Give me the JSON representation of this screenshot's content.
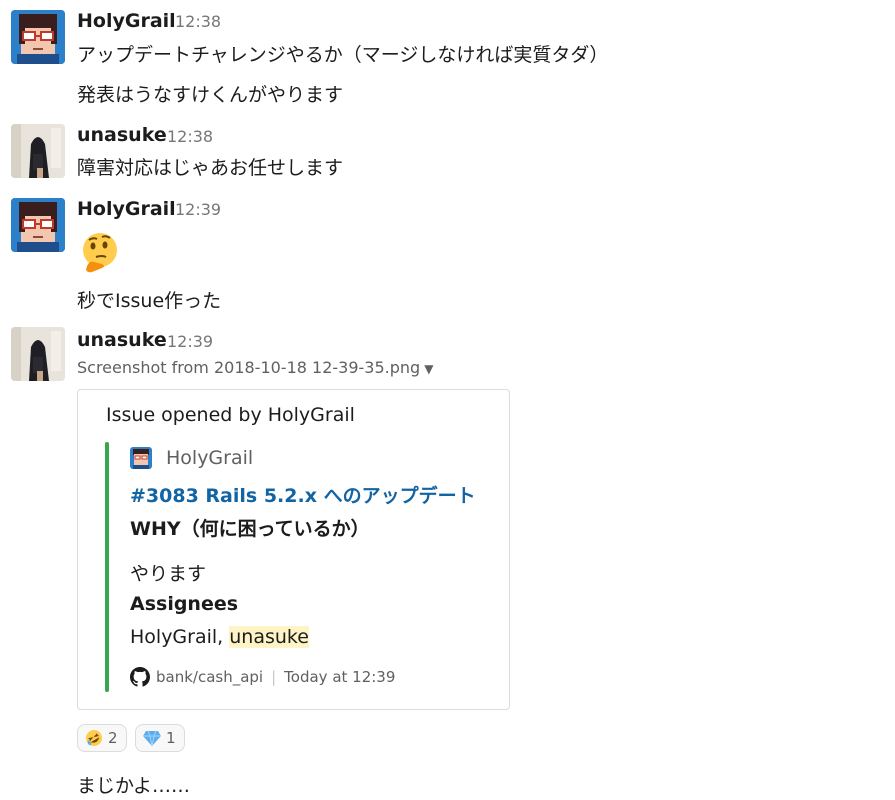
{
  "messages": [
    {
      "author": "HolyGrail",
      "time": "12:38",
      "lines": [
        "アップデートチャレンジやるか（マージしなければ実質タダ）",
        "発表はうなすけくんがやります"
      ]
    },
    {
      "author": "unasuke",
      "time": "12:38",
      "lines": [
        "障害対応はじゃあお任せします"
      ]
    },
    {
      "author": "HolyGrail",
      "time": "12:39",
      "emoji": "thinking-face",
      "lines": [
        "秒でIssue作った"
      ]
    },
    {
      "author": "unasuke",
      "time": "12:39",
      "file_name": "Screenshot from 2018-10-18 12-39-35.png",
      "attachment": {
        "pretext": "Issue opened by HolyGrail",
        "author_name": "HolyGrail",
        "title": "#3083 Rails 5.2.x へのアップデート",
        "field_title": "WHY（何に困っているか）",
        "text": "やります",
        "assignees_title": "Assignees",
        "assignees_plain": "HolyGrail, ",
        "assignees_mention": "unasuke",
        "footer_repo": "bank/cash_api",
        "footer_time": "Today at 12:39",
        "bar_color": "#36a64f"
      },
      "reactions": [
        {
          "emoji": "rolling-on-floor-laughing",
          "count": "2"
        },
        {
          "emoji": "gem",
          "count": "1"
        }
      ]
    }
  ],
  "last_message": "まじかよ……",
  "colors": {
    "link": "#1264a3",
    "mention_bg": "#fef4c5",
    "muted": "#616061"
  }
}
